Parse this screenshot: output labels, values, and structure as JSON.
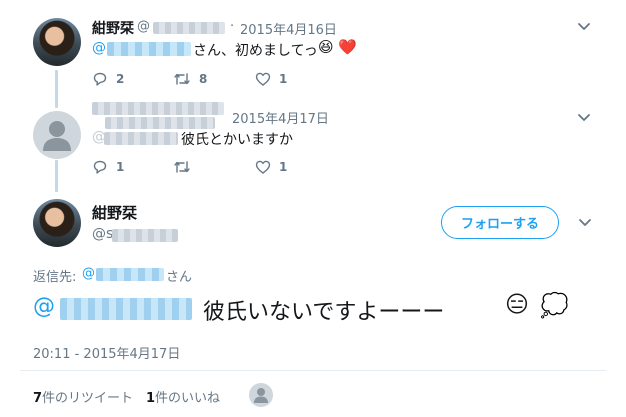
{
  "tweets": [
    {
      "author_name": "紺野栞",
      "handle_prefix": "@",
      "separator": "·",
      "date": "2015年4月16日",
      "mention_prefix": "@",
      "text": "さん、初めましてっ",
      "emoji": [
        "😆",
        "❤️"
      ],
      "counts": {
        "reply": "2",
        "retweet": "8",
        "like": "1"
      }
    },
    {
      "date": "2015年4月17日",
      "mention_prefix": "@",
      "text": "彼氏とかいますか",
      "counts": {
        "reply": "1",
        "like": "1"
      }
    }
  ],
  "main_tweet": {
    "author_name": "紺野栞",
    "handle_prefix": "@s",
    "follow_label": "フォローする",
    "reply_to_label": "返信先:",
    "reply_to_prefix": "@",
    "reply_to_suffix": "さん",
    "mention_prefix": "@",
    "text": "彼氏いないですよーーー",
    "emoji": [
      "😑",
      "💭"
    ],
    "timestamp": "20:11 - 2015年4月17日",
    "retweets_count": "7",
    "retweets_label": "件のリツイート",
    "likes_count": "1",
    "likes_label": "件のいいね"
  },
  "icons": [
    "reply-icon",
    "retweet-icon",
    "like-icon",
    "chevron-down-icon"
  ],
  "colors": {
    "accent": "#1da1f2",
    "thread_line": "#c4d9e8",
    "muted": "#657786"
  }
}
